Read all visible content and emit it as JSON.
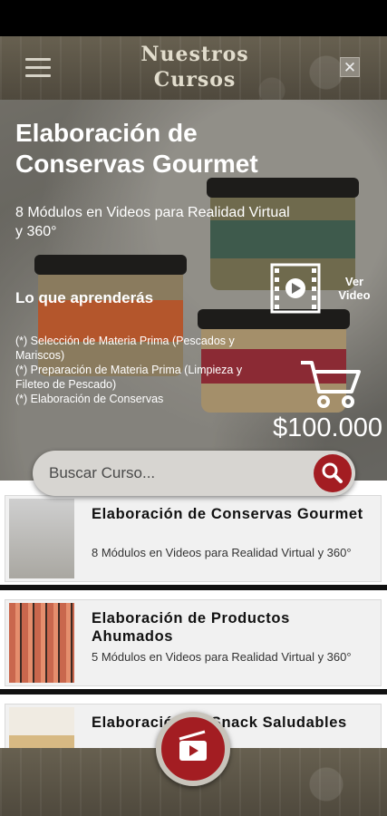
{
  "header": {
    "title": "Nuestros Cursos"
  },
  "hero": {
    "title": "Elaboración de Conservas Gourmet",
    "subtitle": "8 Módulos en Videos para Realidad Virtual y 360°",
    "learn_heading": "Lo que aprenderás",
    "learn_items": [
      "(*) Selección de Materia Prima (Pescados y Mariscos)",
      "(*) Preparación de Materia Prima (Limpieza y Fileteo de Pescado)",
      "(*) Elaboración de Conservas"
    ],
    "video_label": "Ver Video",
    "price": "$100.000"
  },
  "search": {
    "placeholder": "Buscar Curso..."
  },
  "courses": [
    {
      "title": "Elaboración de Conservas Gourmet",
      "description": "8 Módulos en Videos para Realidad Virtual y 360°"
    },
    {
      "title": "Elaboración de Productos Ahumados",
      "description": "5 Módulos en Videos para Realidad Virtual y 360°"
    },
    {
      "title": "Elaboración de Snack Saludables",
      "description": ""
    }
  ],
  "icons": {
    "menu": "menu-icon",
    "close": "close-icon",
    "video": "film-play-icon",
    "cart": "shopping-cart-icon",
    "search": "search-icon",
    "fab": "video-player-icon"
  },
  "colors": {
    "accent": "#a31d22",
    "header_bg": "#5c5547"
  }
}
